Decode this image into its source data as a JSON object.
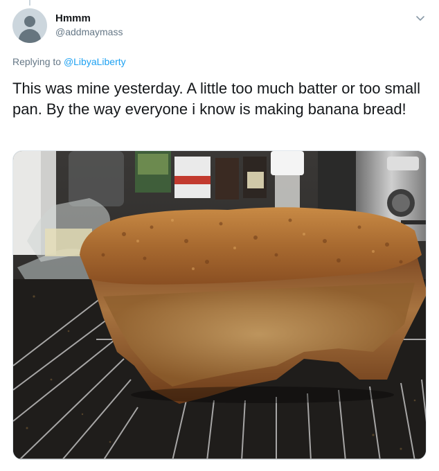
{
  "user": {
    "display_name": "Hmmm",
    "handle": "@addmaymass",
    "avatar_icon": "default-avatar-icon"
  },
  "reply": {
    "prefix": "Replying to ",
    "mention": "@LibyaLiberty"
  },
  "tweet": {
    "text": "This was mine yesterday. A little too much batter or too small pan. By the way everyone i know is making banana bread!"
  },
  "media": {
    "icon": "photo-banana-bread",
    "bread_color": "#9c5a25",
    "countertop_color": "#1f1d1b"
  },
  "menu": {
    "icon": "chevron-down-icon"
  },
  "colors": {
    "link": "#1da1f2",
    "text": "#14171a",
    "muted": "#657786"
  }
}
